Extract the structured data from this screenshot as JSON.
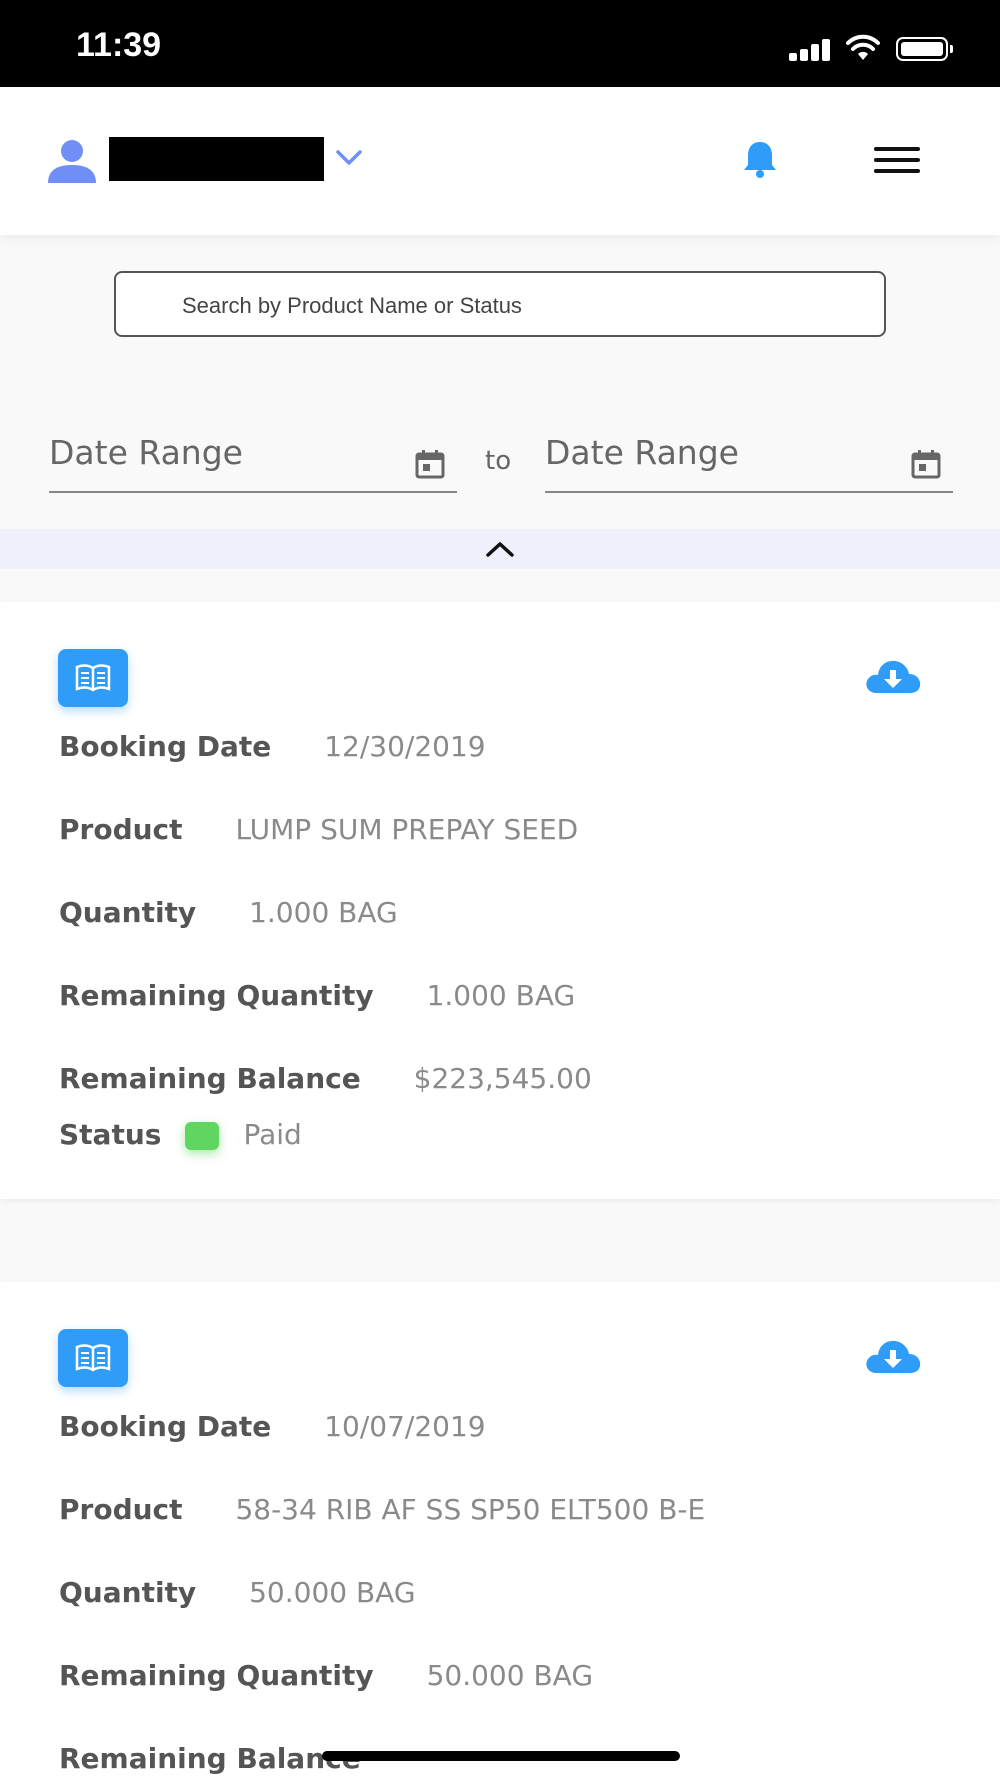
{
  "status_bar": {
    "time": "11:39"
  },
  "header": {
    "user_icon": "user-icon",
    "dropdown_icon": "chevron-down-icon",
    "notification_icon": "bell-icon",
    "menu_icon": "hamburger-icon"
  },
  "search": {
    "placeholder": "Search by Product Name or Status"
  },
  "filters": {
    "start_label": "Date Range",
    "separator": "to",
    "end_label": "Date Range",
    "calendar_icon": "calendar-icon",
    "collapse_icon": "chevron-up-icon"
  },
  "colors": {
    "accent": "#2f9cf7",
    "status_paid": "#5fd65f",
    "redacted": "#000000"
  },
  "labels": {
    "booking_date": "Booking Date",
    "product": "Product",
    "quantity": "Quantity",
    "remaining_quantity": "Remaining Quantity",
    "remaining_balance": "Remaining Balance",
    "status": "Status"
  },
  "bookings": [
    {
      "booking_date": "12/30/2019",
      "product": "LUMP SUM PREPAY SEED",
      "quantity": "1.000 BAG",
      "remaining_quantity": "1.000 BAG",
      "remaining_balance": "$223,545.00",
      "status": "Paid"
    },
    {
      "booking_date": "10/07/2019",
      "product": "58-34 RIB AF SS SP50 ELT500 B-E",
      "quantity": "50.000 BAG",
      "remaining_quantity": "50.000 BAG",
      "remaining_balance_label": "Remaining Balance"
    }
  ]
}
